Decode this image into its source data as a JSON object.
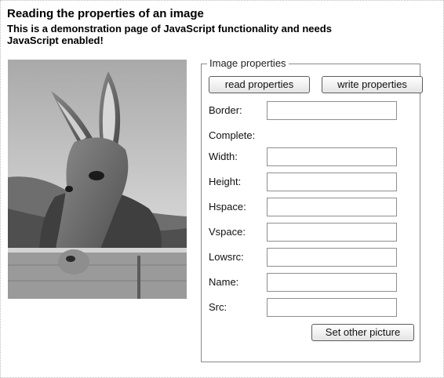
{
  "page": {
    "title": "Reading the properties of an image",
    "intro": "This is a demonstration page of JavaScript functionality and needs JavaScript enabled!"
  },
  "image": {
    "subject": "donkey-photo",
    "colors": {
      "sky": "#c9c9c9",
      "fence": "#8f8f8f",
      "donkey": "#6b6b6b"
    }
  },
  "properties": {
    "legend": "Image properties",
    "read_label": "read properties",
    "write_label": "write properties",
    "border_label": "Border:",
    "border_value": "",
    "complete_label": "Complete:",
    "width_label": "Width:",
    "width_value": "",
    "height_label": "Height:",
    "height_value": "",
    "hspace_label": "Hspace:",
    "hspace_value": "",
    "vspace_label": "Vspace:",
    "vspace_value": "",
    "lowsrc_label": "Lowsrc:",
    "lowsrc_value": "",
    "name_label": "Name:",
    "name_value": "",
    "src_label": "Src:",
    "src_value": "",
    "set_picture_label": "Set other picture"
  }
}
